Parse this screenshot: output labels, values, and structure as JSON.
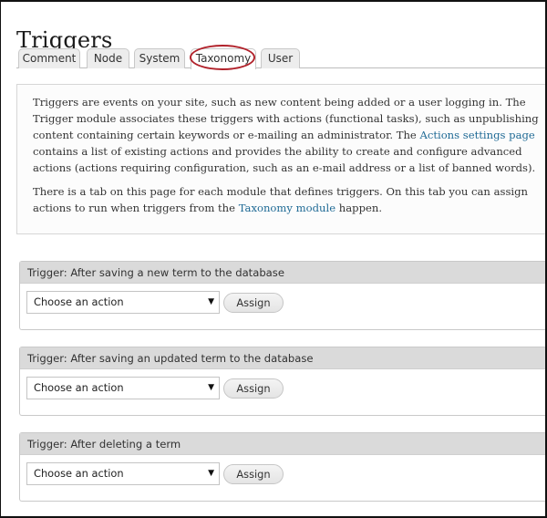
{
  "page": {
    "title": "Triggers"
  },
  "tabs": [
    {
      "label": "Comment",
      "active": false
    },
    {
      "label": "Node",
      "active": false
    },
    {
      "label": "System",
      "active": false
    },
    {
      "label": "Taxonomy",
      "active": true,
      "highlighted": true
    },
    {
      "label": "User",
      "active": false
    }
  ],
  "annotation": {
    "highlight_color": "#b1222b",
    "highlighted_tab": "Taxonomy"
  },
  "help": {
    "p1_text_a": "Triggers are events on your site, such as new content being added or a user logging in. The Trigger module associates these triggers with actions (functional tasks), such as unpublishing content containing certain keywords or e-mailing an administrator. The ",
    "p1_link": "Actions settings page",
    "p1_text_b": " contains a list of existing actions and provides the ability to create and configure advanced actions (actions requiring configuration, such as an e-mail address or a list of banned words).",
    "p2_text_a": "There is a tab on this page for each module that defines triggers. On this tab you can assign actions to run when triggers from the ",
    "p2_link": "Taxonomy module",
    "p2_text_b": " happen."
  },
  "triggers": [
    {
      "legend": "Trigger: After saving a new term to the database",
      "select_value": "Choose an action",
      "button_label": "Assign"
    },
    {
      "legend": "Trigger: After saving an updated term to the database",
      "select_value": "Choose an action",
      "button_label": "Assign"
    },
    {
      "legend": "Trigger: After deleting a term",
      "select_value": "Choose an action",
      "button_label": "Assign"
    }
  ],
  "icons": {
    "dropdown_arrow": "▼"
  },
  "colors": {
    "link": "#1f6a95",
    "legend_bg": "#dadada",
    "tab_bg": "#ededed"
  }
}
